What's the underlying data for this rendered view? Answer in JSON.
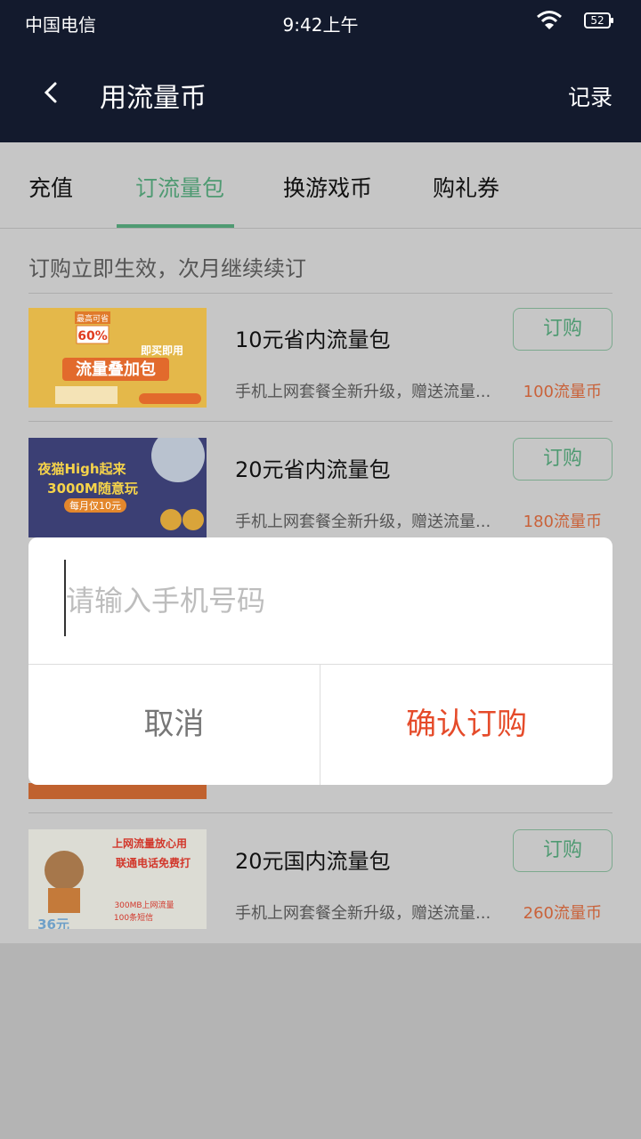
{
  "status_bar": {
    "carrier": "中国电信",
    "time": "9:42上午",
    "battery": "52"
  },
  "app_bar": {
    "title": "用流量币",
    "record_label": "记录"
  },
  "tabs": [
    {
      "label": "充值"
    },
    {
      "label": "订流量包",
      "active": true
    },
    {
      "label": "换游戏币"
    },
    {
      "label": "购礼券"
    }
  ],
  "notice": "订购立即生效，次月继续续订",
  "items": [
    {
      "title": "10元省内流量包",
      "desc": "手机上网套餐全新升级，赠送流量...",
      "price": "100流量币",
      "button": "订购",
      "banner": {
        "badge": "最高可省",
        "pct": "60%",
        "slogan": "即买即用",
        "name": "流量叠加包"
      }
    },
    {
      "title": "20元省内流量包",
      "desc": "手机上网套餐全新升级，赠送流量...",
      "price": "180流量币",
      "button": "订购",
      "banner": {
        "line1": "夜猫High起来",
        "line2": "3000M随意玩",
        "line3": "每月仅10元"
      }
    },
    {
      "title": "20元国内流量包",
      "desc": "手机上网套餐全新升级，赠送流量...",
      "price": "260流量币",
      "button": "订购",
      "banner": {
        "line1": "上网流量放心用",
        "line2": "联通电话免费打",
        "line3": "300MB上网流量",
        "line4": "100条短信",
        "corner": "36元"
      }
    }
  ],
  "dialog": {
    "placeholder": "请输入手机号码",
    "value": "",
    "cancel_label": "取消",
    "confirm_label": "确认订购"
  },
  "colors": {
    "app_bar": "#131a2d",
    "accent_green": "#4f9a72",
    "price_orange": "#c9623a",
    "confirm_red": "#e54b2a"
  }
}
